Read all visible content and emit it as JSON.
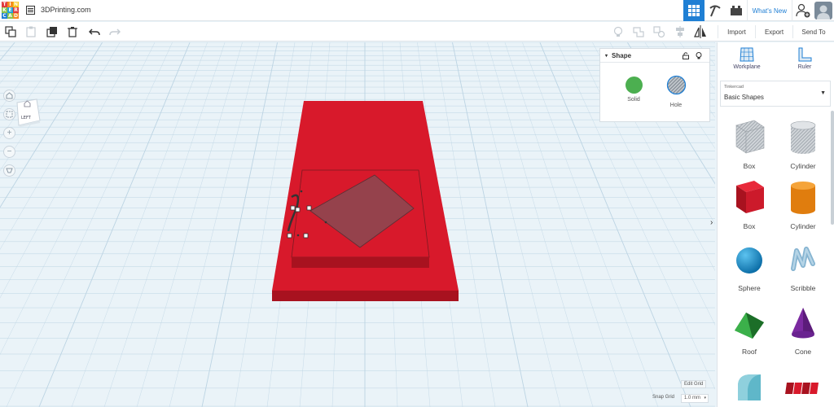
{
  "app": {
    "logo_letters": [
      "T",
      "I",
      "N",
      "K",
      "E",
      "R",
      "C",
      "A",
      "D"
    ],
    "logo_colors": [
      "#e03a3e",
      "#f58a1f",
      "#f5c518",
      "#8bc34a",
      "#1fa3d8",
      "#e03a3e",
      "#1f7fd4",
      "#8bc34a",
      "#f58a1f"
    ],
    "design_title": "3DPrinting.com"
  },
  "topbar": {
    "whats_new": "What's New"
  },
  "toolbar": {
    "import": "Import",
    "export": "Export",
    "send_to": "Send To"
  },
  "viewcube": {
    "face_label": "LEFT"
  },
  "shape_panel": {
    "title": "Shape",
    "solid_label": "Solid",
    "hole_label": "Hole",
    "solid_color": "#4caf50"
  },
  "sidebar": {
    "workplane_label": "Workplane",
    "ruler_label": "Ruler",
    "library_category": "Tinkercad",
    "library_name": "Basic Shapes",
    "shapes": [
      {
        "label": "Box",
        "icon": "box-hole-icon"
      },
      {
        "label": "Cylinder",
        "icon": "cylinder-hole-icon"
      },
      {
        "label": "Box",
        "icon": "box-icon"
      },
      {
        "label": "Cylinder",
        "icon": "cylinder-icon"
      },
      {
        "label": "Sphere",
        "icon": "sphere-icon"
      },
      {
        "label": "Scribble",
        "icon": "scribble-icon"
      },
      {
        "label": "Roof",
        "icon": "roof-icon"
      },
      {
        "label": "Cone",
        "icon": "cone-icon"
      },
      {
        "label": "",
        "icon": "round-roof-icon"
      },
      {
        "label": "",
        "icon": "text-icon"
      }
    ]
  },
  "canvas": {
    "edit_grid": "Edit Grid",
    "snap_grid_label": "Snap Grid",
    "snap_grid_value": "1.0 mm"
  },
  "colors": {
    "accent": "#1f7fd4",
    "model_red": "#d8192b",
    "grid_bg": "#eaf3f8"
  }
}
